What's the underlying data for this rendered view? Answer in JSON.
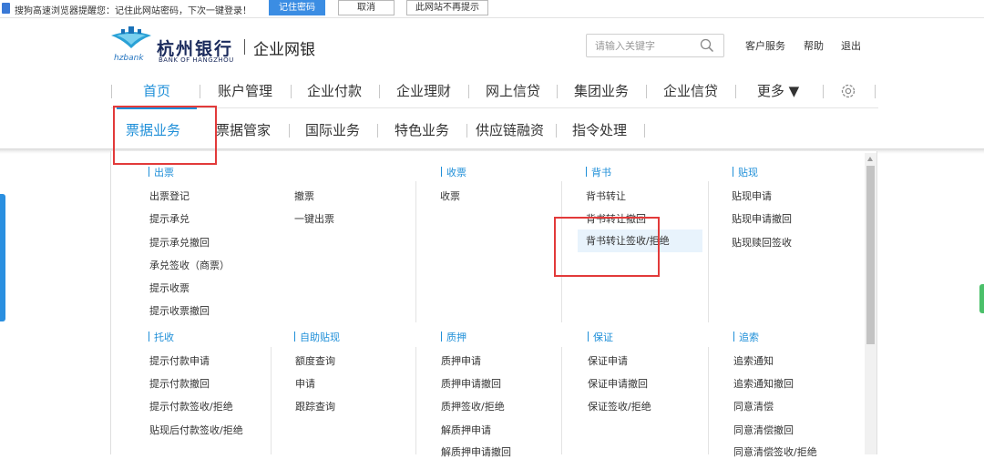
{
  "notification": {
    "message": "搜狗高速浏览器提醒您：记住此网站密码，下次一键登录！",
    "remember_label": "记住密码",
    "cancel_label": "取消",
    "never_label": "此网站不再提示"
  },
  "brand": {
    "name_cn": "杭州银行",
    "subtitle": "企业网银",
    "hz": "hzbank",
    "name_en": "BANK OF HANGZHOU"
  },
  "search": {
    "placeholder": "请输入关键字"
  },
  "top_links": {
    "service": "客户服务",
    "help": "帮助",
    "logout": "退出"
  },
  "main_nav": [
    {
      "label": "首页"
    },
    {
      "label": "账户管理"
    },
    {
      "label": "企业付款"
    },
    {
      "label": "企业理财"
    },
    {
      "label": "网上信贷"
    },
    {
      "label": "集团业务"
    },
    {
      "label": "企业信贷"
    },
    {
      "label": "更多 ▼"
    }
  ],
  "sub_nav": [
    {
      "label": "票据业务"
    },
    {
      "label": "票据管家"
    },
    {
      "label": "国际业务"
    },
    {
      "label": "特色业务"
    },
    {
      "label": "供应链融资"
    },
    {
      "label": "指令处理"
    }
  ],
  "menu": {
    "chupiao": {
      "title": "出票",
      "col1": [
        "出票登记",
        "提示承兑",
        "提示承兑撤回",
        "承兑签收（商票）",
        "提示收票",
        "提示收票撤回"
      ],
      "col2": [
        "撤票",
        "一键出票"
      ]
    },
    "shoupiao": {
      "title": "收票",
      "items": [
        "收票"
      ]
    },
    "beishu": {
      "title": "背书",
      "items": [
        "背书转让",
        "背书转让撤回",
        "背书转让签收/拒绝"
      ]
    },
    "tiexian": {
      "title": "贴现",
      "items": [
        "贴现申请",
        "贴现申请撤回",
        "贴现赎回签收"
      ]
    },
    "tuoshou": {
      "title": "托收",
      "items": [
        "提示付款申请",
        "提示付款撤回",
        "提示付款签收/拒绝",
        "贴现后付款签收/拒绝"
      ]
    },
    "zizhu": {
      "title": "自助贴现",
      "items": [
        "额度查询",
        "申请",
        "跟踪查询"
      ]
    },
    "zhiya": {
      "title": "质押",
      "items": [
        "质押申请",
        "质押申请撤回",
        "质押签收/拒绝",
        "解质押申请",
        "解质押申请撤回"
      ]
    },
    "baozheng": {
      "title": "保证",
      "items": [
        "保证申请",
        "保证申请撤回",
        "保证签收/拒绝"
      ]
    },
    "zhuisuo": {
      "title": "追索",
      "items": [
        "追索通知",
        "追索通知撤回",
        "同意清偿",
        "同意清偿撤回",
        "同意清偿签收/拒绝"
      ]
    }
  },
  "colors": {
    "accent": "#1f8fd8",
    "annotation": "#e23a3a"
  }
}
